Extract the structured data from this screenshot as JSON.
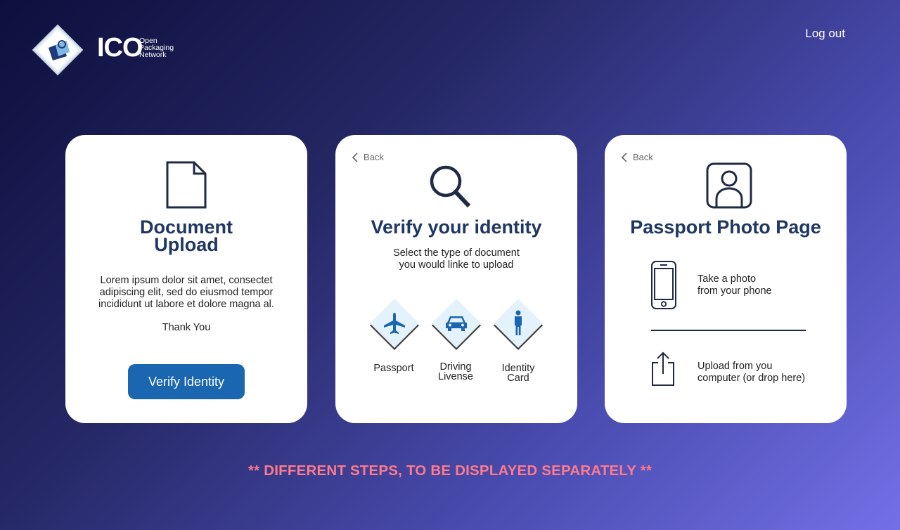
{
  "header": {
    "logo_title": "ICO",
    "logo_sub": [
      "Open",
      "Packaging",
      "Network"
    ],
    "logout_label": "Log out"
  },
  "card_upload": {
    "title_line1": "Document",
    "title_line2": "Upload",
    "body_lines": [
      "Lorem ipsum dolor sit amet, consectet",
      "adipiscing elit, sed do eiusmod tempor",
      "incididunt ut labore et dolore magna al."
    ],
    "thanks": "Thank You",
    "button_label": "Verify Identity"
  },
  "card_verify": {
    "back_label": "Back",
    "title": "Verify your identity",
    "subtitle_line1": "Select the type of document",
    "subtitle_line2": "you would linke to upload",
    "options": [
      {
        "label_line1": "Passport",
        "label_line2": "",
        "icon": "plane-icon"
      },
      {
        "label_line1": "Driving",
        "label_line2": "Livense",
        "icon": "car-icon"
      },
      {
        "label_line1": "Identity",
        "label_line2": "Card",
        "icon": "person-icon"
      }
    ]
  },
  "card_photo": {
    "back_label": "Back",
    "title": "Passport Photo Page",
    "take_photo_line1": "Take a photo",
    "take_photo_line2": "from your phone",
    "upload_line1": "Upload from you",
    "upload_line2": "computer (or drop here)"
  },
  "footer_note": "** DIFFERENT STEPS, TO BE DISPLAYED SEPARATELY **",
  "colors": {
    "accent": "#1a66b0",
    "title": "#1f3761",
    "note": "#ff7a8a",
    "tile_fill": "#e3f2fb"
  }
}
